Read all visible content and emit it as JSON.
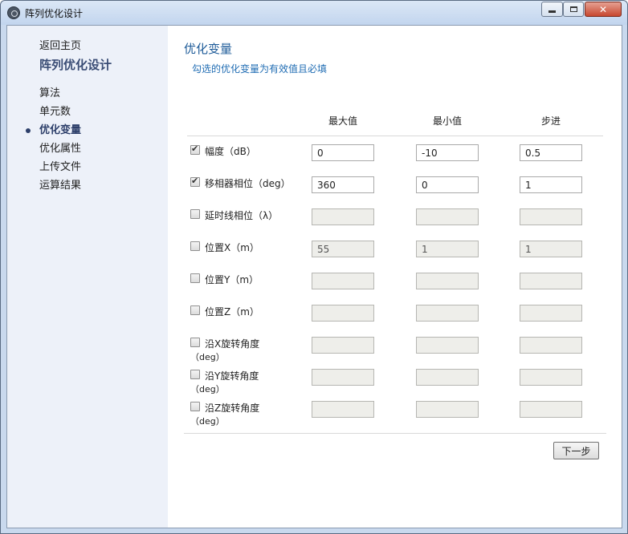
{
  "window": {
    "title": "阵列优化设计",
    "icons": {
      "app": "app-icon",
      "minimize": "minimize-icon",
      "maximize": "maximize-icon",
      "close": "close-icon"
    },
    "close_glyph": "✕"
  },
  "sidebar": {
    "home": "返回主页",
    "title": "阵列优化设计",
    "items": [
      {
        "label": "算法",
        "active": false
      },
      {
        "label": "单元数",
        "active": false
      },
      {
        "label": "优化变量",
        "active": true
      },
      {
        "label": "优化属性",
        "active": false
      },
      {
        "label": "上传文件",
        "active": false
      },
      {
        "label": "运算结果",
        "active": false
      }
    ]
  },
  "main": {
    "title": "优化变量",
    "subtitle": "勾选的优化变量为有效值且必填",
    "columns": {
      "max": "最大值",
      "min": "最小值",
      "step": "步进"
    },
    "rows": [
      {
        "label": "幅度（dB）",
        "label2": "",
        "checked": true,
        "max": "0",
        "min": "-10",
        "step": "0.5"
      },
      {
        "label": "移相器相位（deg）",
        "label2": "",
        "checked": true,
        "max": "360",
        "min": "0",
        "step": "1"
      },
      {
        "label": "延时线相位（λ）",
        "label2": "",
        "checked": false,
        "max": "",
        "min": "",
        "step": ""
      },
      {
        "label": "位置X（m）",
        "label2": "",
        "checked": false,
        "max": "55",
        "min": "1",
        "step": "1"
      },
      {
        "label": "位置Y（m）",
        "label2": "",
        "checked": false,
        "max": "",
        "min": "",
        "step": ""
      },
      {
        "label": "位置Z（m）",
        "label2": "",
        "checked": false,
        "max": "",
        "min": "",
        "step": ""
      },
      {
        "label": "沿X旋转角度",
        "label2": "（deg）",
        "checked": false,
        "max": "",
        "min": "",
        "step": ""
      },
      {
        "label": "沿Y旋转角度",
        "label2": "（deg）",
        "checked": false,
        "max": "",
        "min": "",
        "step": ""
      },
      {
        "label": "沿Z旋转角度",
        "label2": "（deg）",
        "checked": false,
        "max": "",
        "min": "",
        "step": ""
      }
    ],
    "next_button": "下一步"
  }
}
